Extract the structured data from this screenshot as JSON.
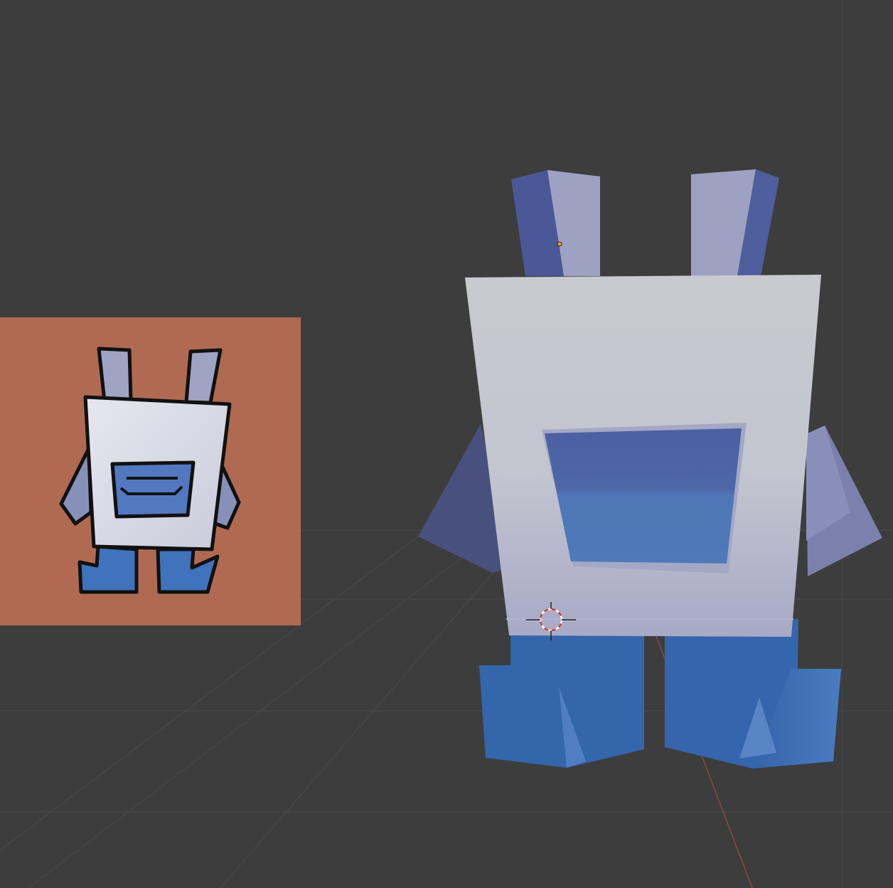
{
  "viewport": {
    "type": "3d-viewport",
    "background": "#3d3d3d",
    "grid_color": "#4a4a4a",
    "x_axis_color": "#b34b4b"
  },
  "reference_image": {
    "kind": "image-plane",
    "background": "#b06a52",
    "subject": "cartoon-character"
  },
  "model": {
    "kind": "low-poly-character",
    "body_color": "#c9cbd6",
    "accent_color": "#3a6fb5",
    "shadow_color": "#4c5a96",
    "selected": true
  },
  "cursor_3d": {
    "visible": true
  },
  "origin_dot": {
    "visible": true,
    "color": "#f0a030"
  }
}
